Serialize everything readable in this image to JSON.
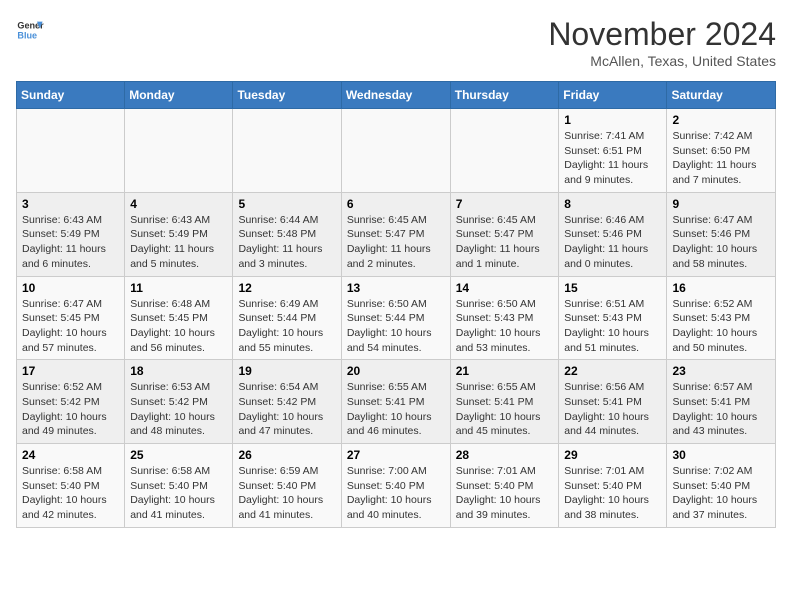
{
  "header": {
    "logo_line1": "General",
    "logo_line2": "Blue",
    "month": "November 2024",
    "location": "McAllen, Texas, United States"
  },
  "days_of_week": [
    "Sunday",
    "Monday",
    "Tuesday",
    "Wednesday",
    "Thursday",
    "Friday",
    "Saturday"
  ],
  "weeks": [
    [
      {
        "day": "",
        "info": ""
      },
      {
        "day": "",
        "info": ""
      },
      {
        "day": "",
        "info": ""
      },
      {
        "day": "",
        "info": ""
      },
      {
        "day": "",
        "info": ""
      },
      {
        "day": "1",
        "info": "Sunrise: 7:41 AM\nSunset: 6:51 PM\nDaylight: 11 hours and 9 minutes."
      },
      {
        "day": "2",
        "info": "Sunrise: 7:42 AM\nSunset: 6:50 PM\nDaylight: 11 hours and 7 minutes."
      }
    ],
    [
      {
        "day": "3",
        "info": "Sunrise: 6:43 AM\nSunset: 5:49 PM\nDaylight: 11 hours and 6 minutes."
      },
      {
        "day": "4",
        "info": "Sunrise: 6:43 AM\nSunset: 5:49 PM\nDaylight: 11 hours and 5 minutes."
      },
      {
        "day": "5",
        "info": "Sunrise: 6:44 AM\nSunset: 5:48 PM\nDaylight: 11 hours and 3 minutes."
      },
      {
        "day": "6",
        "info": "Sunrise: 6:45 AM\nSunset: 5:47 PM\nDaylight: 11 hours and 2 minutes."
      },
      {
        "day": "7",
        "info": "Sunrise: 6:45 AM\nSunset: 5:47 PM\nDaylight: 11 hours and 1 minute."
      },
      {
        "day": "8",
        "info": "Sunrise: 6:46 AM\nSunset: 5:46 PM\nDaylight: 11 hours and 0 minutes."
      },
      {
        "day": "9",
        "info": "Sunrise: 6:47 AM\nSunset: 5:46 PM\nDaylight: 10 hours and 58 minutes."
      }
    ],
    [
      {
        "day": "10",
        "info": "Sunrise: 6:47 AM\nSunset: 5:45 PM\nDaylight: 10 hours and 57 minutes."
      },
      {
        "day": "11",
        "info": "Sunrise: 6:48 AM\nSunset: 5:45 PM\nDaylight: 10 hours and 56 minutes."
      },
      {
        "day": "12",
        "info": "Sunrise: 6:49 AM\nSunset: 5:44 PM\nDaylight: 10 hours and 55 minutes."
      },
      {
        "day": "13",
        "info": "Sunrise: 6:50 AM\nSunset: 5:44 PM\nDaylight: 10 hours and 54 minutes."
      },
      {
        "day": "14",
        "info": "Sunrise: 6:50 AM\nSunset: 5:43 PM\nDaylight: 10 hours and 53 minutes."
      },
      {
        "day": "15",
        "info": "Sunrise: 6:51 AM\nSunset: 5:43 PM\nDaylight: 10 hours and 51 minutes."
      },
      {
        "day": "16",
        "info": "Sunrise: 6:52 AM\nSunset: 5:43 PM\nDaylight: 10 hours and 50 minutes."
      }
    ],
    [
      {
        "day": "17",
        "info": "Sunrise: 6:52 AM\nSunset: 5:42 PM\nDaylight: 10 hours and 49 minutes."
      },
      {
        "day": "18",
        "info": "Sunrise: 6:53 AM\nSunset: 5:42 PM\nDaylight: 10 hours and 48 minutes."
      },
      {
        "day": "19",
        "info": "Sunrise: 6:54 AM\nSunset: 5:42 PM\nDaylight: 10 hours and 47 minutes."
      },
      {
        "day": "20",
        "info": "Sunrise: 6:55 AM\nSunset: 5:41 PM\nDaylight: 10 hours and 46 minutes."
      },
      {
        "day": "21",
        "info": "Sunrise: 6:55 AM\nSunset: 5:41 PM\nDaylight: 10 hours and 45 minutes."
      },
      {
        "day": "22",
        "info": "Sunrise: 6:56 AM\nSunset: 5:41 PM\nDaylight: 10 hours and 44 minutes."
      },
      {
        "day": "23",
        "info": "Sunrise: 6:57 AM\nSunset: 5:41 PM\nDaylight: 10 hours and 43 minutes."
      }
    ],
    [
      {
        "day": "24",
        "info": "Sunrise: 6:58 AM\nSunset: 5:40 PM\nDaylight: 10 hours and 42 minutes."
      },
      {
        "day": "25",
        "info": "Sunrise: 6:58 AM\nSunset: 5:40 PM\nDaylight: 10 hours and 41 minutes."
      },
      {
        "day": "26",
        "info": "Sunrise: 6:59 AM\nSunset: 5:40 PM\nDaylight: 10 hours and 41 minutes."
      },
      {
        "day": "27",
        "info": "Sunrise: 7:00 AM\nSunset: 5:40 PM\nDaylight: 10 hours and 40 minutes."
      },
      {
        "day": "28",
        "info": "Sunrise: 7:01 AM\nSunset: 5:40 PM\nDaylight: 10 hours and 39 minutes."
      },
      {
        "day": "29",
        "info": "Sunrise: 7:01 AM\nSunset: 5:40 PM\nDaylight: 10 hours and 38 minutes."
      },
      {
        "day": "30",
        "info": "Sunrise: 7:02 AM\nSunset: 5:40 PM\nDaylight: 10 hours and 37 minutes."
      }
    ]
  ]
}
